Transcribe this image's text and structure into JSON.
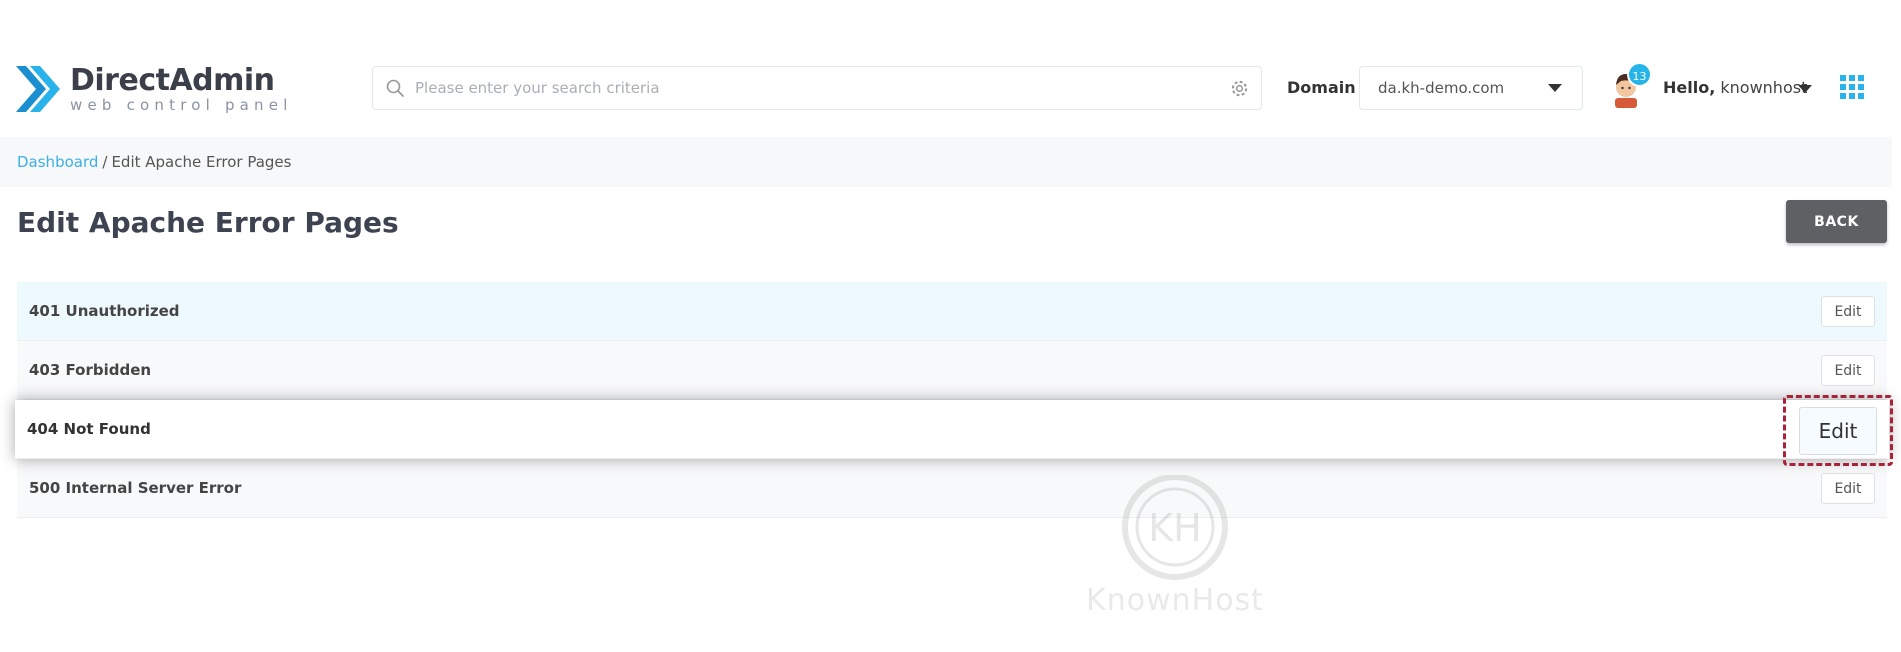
{
  "header": {
    "logo_title": "DirectAdmin",
    "logo_subtitle": "web control panel",
    "search_placeholder": "Please enter your search criteria",
    "domain_label": "Domain",
    "domain_value": "da.kh-demo.com",
    "notification_count": "13",
    "greeting": "Hello,",
    "username": "knownhost"
  },
  "breadcrumb": {
    "root": "Dashboard",
    "separator": "/",
    "current": "Edit Apache Error Pages"
  },
  "page": {
    "title": "Edit Apache Error Pages",
    "back_label": "BACK"
  },
  "error_pages": [
    {
      "label": "401 Unauthorized",
      "action": "Edit"
    },
    {
      "label": "403 Forbidden",
      "action": "Edit"
    },
    {
      "label": "404 Not Found",
      "action": "Edit"
    },
    {
      "label": "500 Internal Server Error",
      "action": "Edit"
    }
  ],
  "watermark": "KnownHost",
  "colors": {
    "accent": "#25b5e8",
    "back_button": "#5f6064",
    "highlight_frame": "#a8233a"
  }
}
